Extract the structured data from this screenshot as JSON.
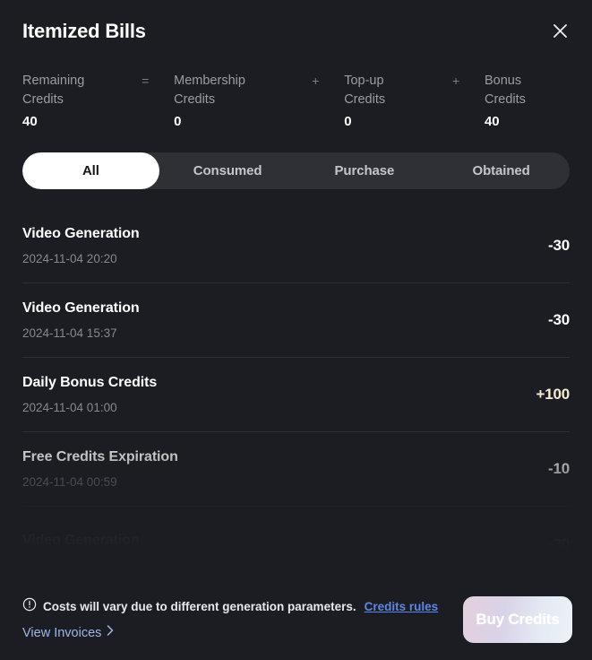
{
  "header": {
    "title": "Itemized Bills",
    "close_icon": "close-icon"
  },
  "summary": {
    "columns": [
      {
        "label_line1": "Remaining",
        "label_line2": "Credits",
        "value": "40"
      },
      {
        "label_line1": "Membership",
        "label_line2": "Credits",
        "value": "0"
      },
      {
        "label_line1": "Top-up",
        "label_line2": "Credits",
        "value": "0"
      },
      {
        "label_line1": "Bonus",
        "label_line2": "Credits",
        "value": "40"
      }
    ],
    "operators": [
      "=",
      "+",
      "+"
    ]
  },
  "tabs": [
    {
      "label": "All",
      "active": true
    },
    {
      "label": "Consumed",
      "active": false
    },
    {
      "label": "Purchase",
      "active": false
    },
    {
      "label": "Obtained",
      "active": false
    }
  ],
  "bills": [
    {
      "title": "Video Generation",
      "date": "2024-11-04 20:20",
      "amount": "-30",
      "kind": "debit"
    },
    {
      "title": "Video Generation",
      "date": "2024-11-04 15:37",
      "amount": "-30",
      "kind": "debit"
    },
    {
      "title": "Daily Bonus Credits",
      "date": "2024-11-04 01:00",
      "amount": "+100",
      "kind": "credit"
    },
    {
      "title": "Free Credits Expiration",
      "date": "2024-11-04 00:59",
      "amount": "-10",
      "kind": "debit"
    },
    {
      "title": "Video Generation",
      "date": "",
      "amount": "-30",
      "kind": "debit"
    }
  ],
  "footer": {
    "info_icon": "info-circle-icon",
    "note": "Costs will vary due to different generation parameters.",
    "credits_rules_label": "Credits rules",
    "view_invoices_label": "View Invoices",
    "chevron_icon": "chevron-right-icon",
    "buy_button_label": "Buy Credits"
  },
  "colors": {
    "background": "#1c1d22",
    "tabbar": "#2f3036",
    "active_tab": "#ffffff",
    "credit_amount": "#f5ecd2",
    "link": "#5b87e8",
    "link_soft": "#9fb6e8",
    "divider": "#2c2d33"
  }
}
